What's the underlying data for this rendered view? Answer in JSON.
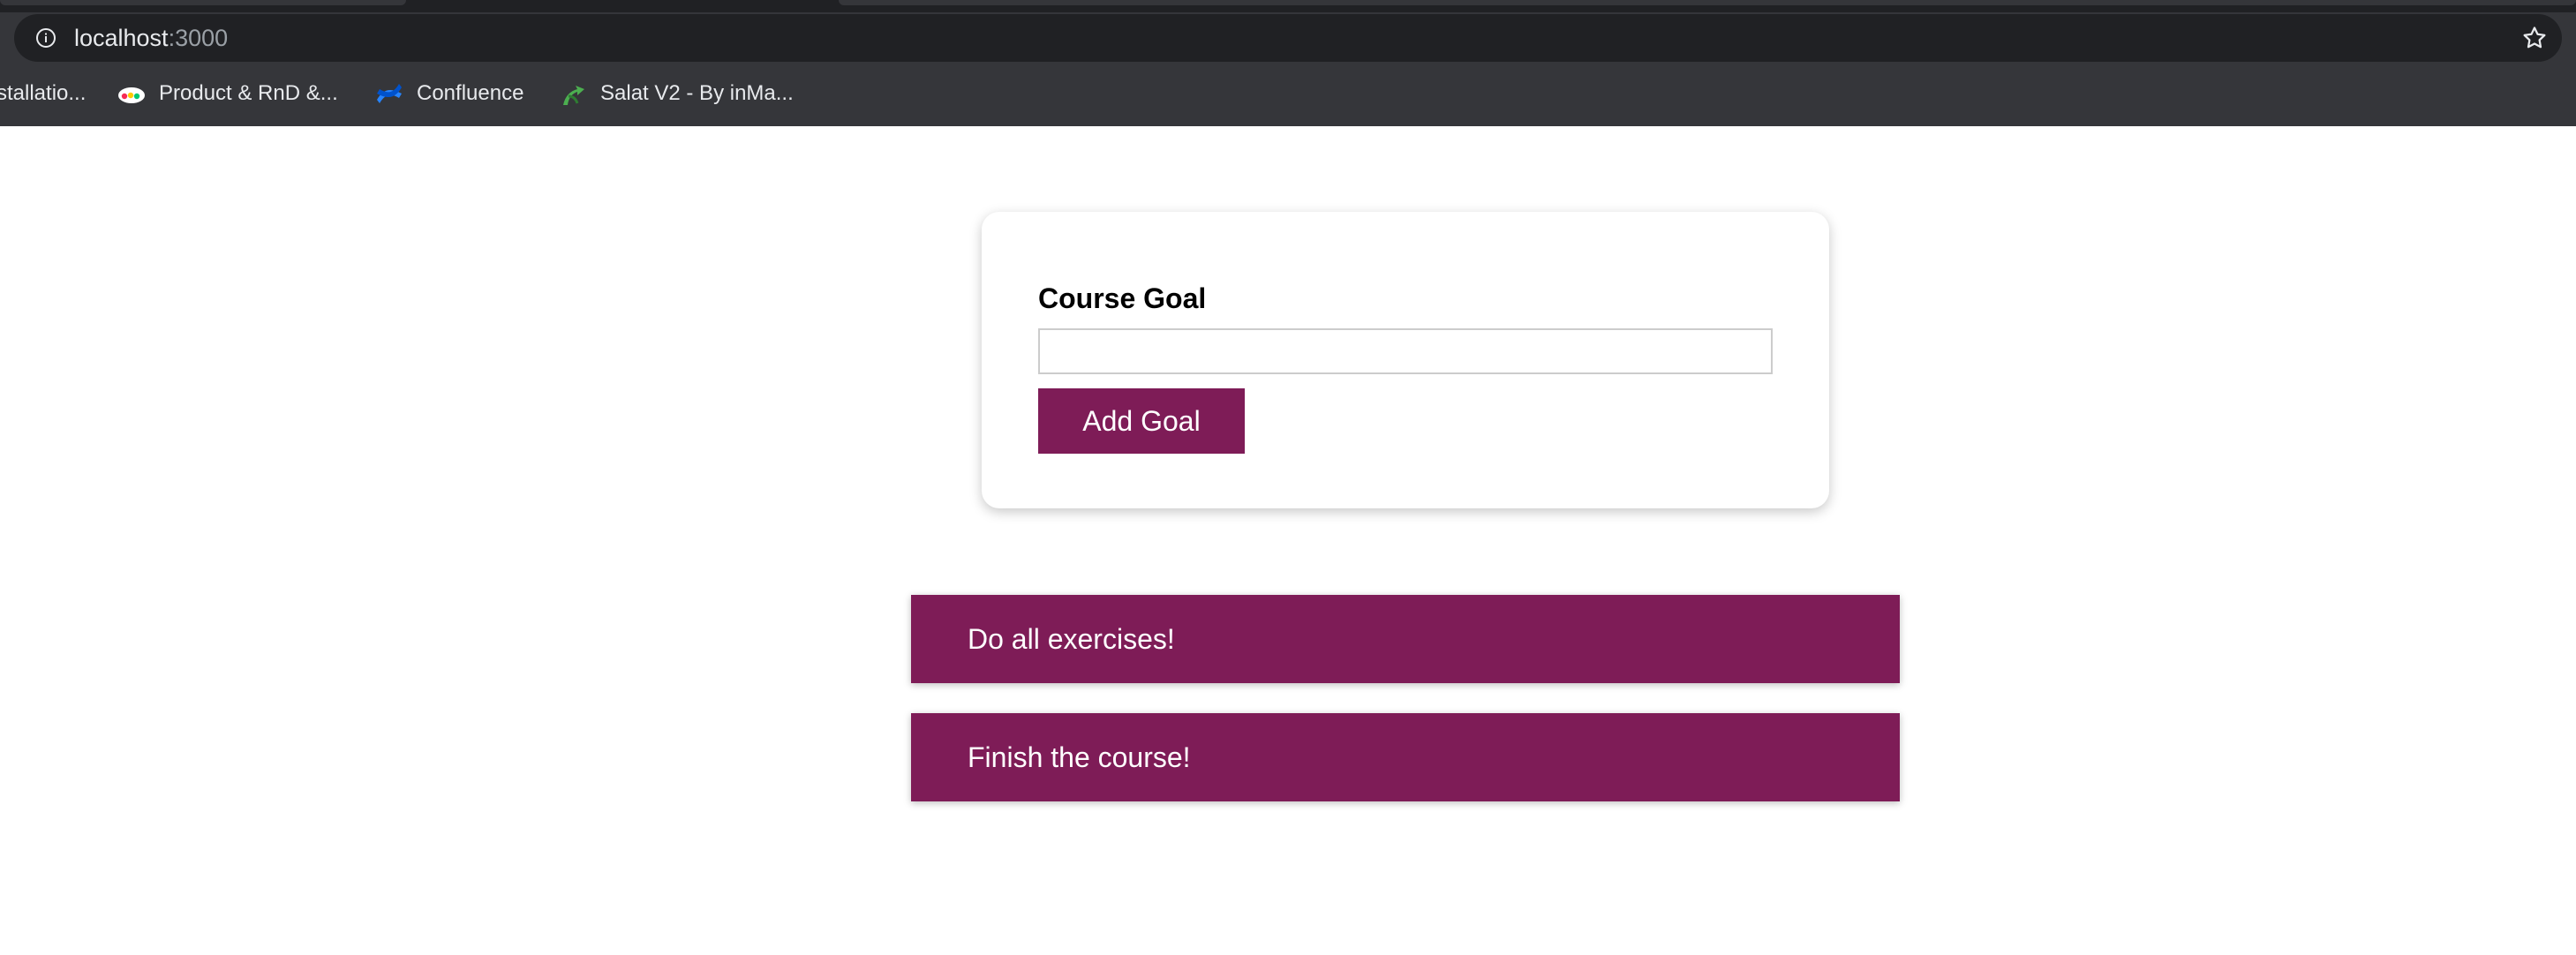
{
  "browser": {
    "url_host": "localhost",
    "url_port": ":3000",
    "bookmarks": [
      {
        "label": "stallatio...",
        "icon": ""
      },
      {
        "label": "Product & RnD &...",
        "icon": "monday-logo-icon"
      },
      {
        "label": "Confluence",
        "icon": "confluence-logo-icon"
      },
      {
        "label": "Salat V2 - By inMa...",
        "icon": "salat-logo-icon"
      }
    ]
  },
  "form": {
    "label": "Course Goal",
    "input_value": "",
    "button_label": "Add Goal"
  },
  "goals": [
    {
      "text": "Do all exercises!"
    },
    {
      "text": "Finish the course!"
    }
  ],
  "colors": {
    "accent": "#7e1c57",
    "chrome_bg": "#35363a",
    "omnibox_bg": "#202124"
  }
}
